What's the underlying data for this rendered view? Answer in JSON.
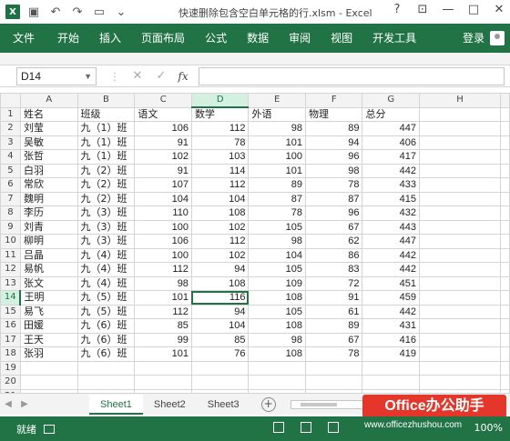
{
  "titlebar": {
    "app_icon": "X",
    "title": "快速删除包含空白单元格的行.xlsm - Excel",
    "controls": [
      "?",
      "⊡",
      "—",
      "□",
      "✕"
    ]
  },
  "ribbon": {
    "tabs": [
      "文件",
      "开始",
      "插入",
      "页面布局",
      "公式",
      "数据",
      "审阅",
      "视图",
      "开发工具"
    ],
    "login": "登录"
  },
  "formula_bar": {
    "name_box": "D14",
    "fx": "fx",
    "value": ""
  },
  "sheet": {
    "columns": [
      "A",
      "B",
      "C",
      "D",
      "E",
      "F",
      "G",
      "H"
    ],
    "selected_column": "D",
    "selected_row": 14,
    "header_row": [
      "姓名",
      "班级",
      "语文",
      "数学",
      "外语",
      "物理",
      "总分",
      ""
    ],
    "rows": [
      [
        "刘莹",
        "九（1）班",
        "106",
        "112",
        "98",
        "89",
        "447",
        ""
      ],
      [
        "吴敏",
        "九（1）班",
        "91",
        "78",
        "101",
        "94",
        "406",
        ""
      ],
      [
        "张哲",
        "九（1）班",
        "102",
        "103",
        "100",
        "96",
        "417",
        ""
      ],
      [
        "白羽",
        "九（2）班",
        "91",
        "114",
        "101",
        "98",
        "442",
        ""
      ],
      [
        "常欣",
        "九（2）班",
        "107",
        "112",
        "89",
        "78",
        "433",
        ""
      ],
      [
        "魏明",
        "九（2）班",
        "104",
        "104",
        "87",
        "87",
        "415",
        ""
      ],
      [
        "李历",
        "九（3）班",
        "110",
        "108",
        "78",
        "96",
        "432",
        ""
      ],
      [
        "刘青",
        "九（3）班",
        "100",
        "102",
        "105",
        "67",
        "443",
        ""
      ],
      [
        "柳明",
        "九（3）班",
        "106",
        "112",
        "98",
        "62",
        "447",
        ""
      ],
      [
        "吕晶",
        "九（4）班",
        "100",
        "102",
        "104",
        "86",
        "442",
        ""
      ],
      [
        "易帆",
        "九（4）班",
        "112",
        "94",
        "105",
        "83",
        "442",
        ""
      ],
      [
        "张文",
        "九（4）班",
        "98",
        "108",
        "109",
        "72",
        "451",
        ""
      ],
      [
        "王明",
        "九（5）班",
        "101",
        "116",
        "108",
        "91",
        "459",
        ""
      ],
      [
        "易飞",
        "九（5）班",
        "112",
        "94",
        "105",
        "61",
        "442",
        ""
      ],
      [
        "田媛",
        "九（6）班",
        "85",
        "104",
        "108",
        "89",
        "431",
        ""
      ],
      [
        "王天",
        "九（6）班",
        "99",
        "85",
        "98",
        "67",
        "416",
        ""
      ],
      [
        "张羽",
        "九（6）班",
        "101",
        "76",
        "108",
        "78",
        "419",
        ""
      ]
    ],
    "empty_rows": [
      19,
      20,
      21
    ]
  },
  "sheet_tabs": {
    "tabs": [
      "Sheet1",
      "Sheet2",
      "Sheet3"
    ],
    "active": "Sheet1"
  },
  "watermark": {
    "label": "Office办公助手",
    "url": "www.officezhushou.com"
  },
  "status_bar": {
    "ready": "就绪",
    "zoom": "100%"
  },
  "colors": {
    "accent": "#217346",
    "watermark": "#e4362b"
  }
}
